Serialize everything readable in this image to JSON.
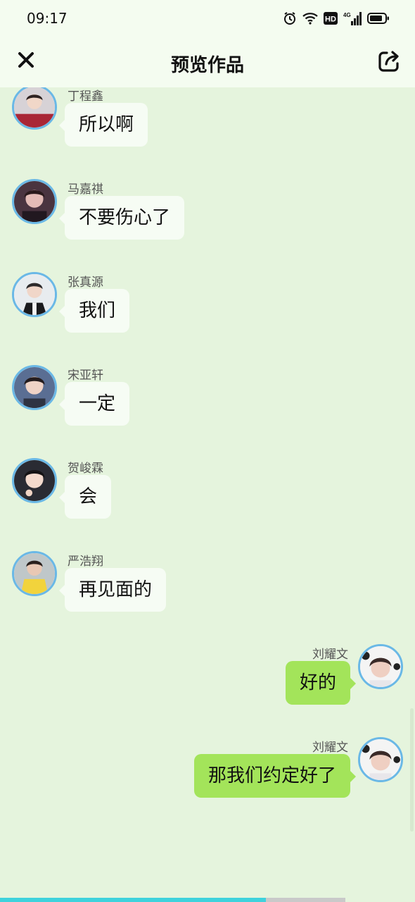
{
  "status_bar": {
    "time": "09:17",
    "icons": [
      "alarm-icon",
      "wifi-icon",
      "hd-icon",
      "signal-4g-icon",
      "battery-icon"
    ],
    "network_label": "4G",
    "hd_label": "HD"
  },
  "header": {
    "title": "预览作品",
    "close_icon": "close-icon",
    "share_icon": "share-icon"
  },
  "messages": [
    {
      "side": "left",
      "name": "丁程鑫",
      "text": "所以啊"
    },
    {
      "side": "left",
      "name": "马嘉祺",
      "text": "不要伤心了"
    },
    {
      "side": "left",
      "name": "张真源",
      "text": "我们"
    },
    {
      "side": "left",
      "name": "宋亚轩",
      "text": "一定"
    },
    {
      "side": "left",
      "name": "贺峻霖",
      "text": "会"
    },
    {
      "side": "left",
      "name": "严浩翔",
      "text": "再见面的"
    },
    {
      "side": "right",
      "name": "刘耀文",
      "text": "好的"
    },
    {
      "side": "right",
      "name": "刘耀文",
      "text": "那我们约定好了"
    }
  ],
  "playback": {
    "progress": 0.77
  },
  "colors": {
    "background": "#e5f4dd",
    "header": "#f4fcf0",
    "bubble_left": "#f6fcf4",
    "bubble_right": "#a3e45a",
    "avatar_border": "#6ab8e6",
    "progress": "#3fd2dc"
  }
}
